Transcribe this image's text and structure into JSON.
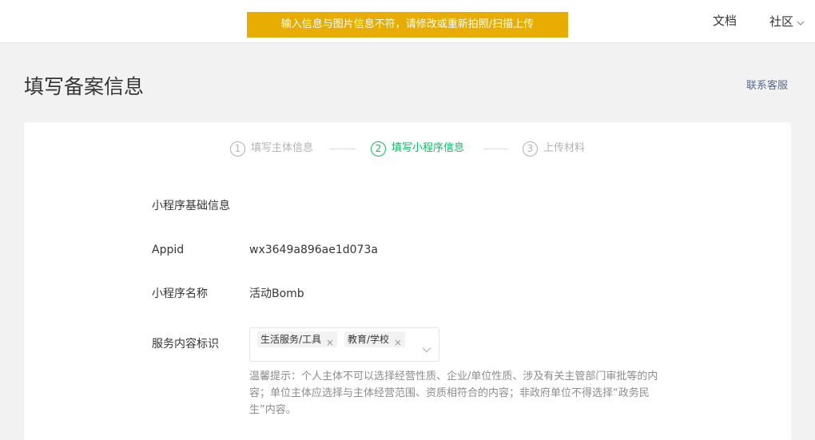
{
  "header": {
    "alert": "输入信息与图片信息不符，请修改或重新拍照/扫描上传",
    "nav_docs": "文档",
    "nav_community": "社区",
    "colors": {
      "alert_bg": "#e8ad00",
      "active": "#07c160",
      "link": "#576b95"
    }
  },
  "page": {
    "title": "填写备案信息",
    "support_link": "联系客服"
  },
  "steps": [
    {
      "num": "1",
      "label": "填写主体信息",
      "state": "done"
    },
    {
      "num": "2",
      "label": "填写小程序信息",
      "state": "active"
    },
    {
      "num": "3",
      "label": "上传材料",
      "state": "pending"
    }
  ],
  "form": {
    "section_title": "小程序基础信息",
    "appid": {
      "label": "Appid",
      "value": "wx3649a896ae1d073a"
    },
    "name": {
      "label": "小程序名称",
      "value": "活动Bomb"
    },
    "service": {
      "label": "服务内容标识",
      "tags": [
        "生活服务/工具",
        "教育/学校"
      ]
    },
    "hint": "温馨提示：个人主体不可以选择经营性质、企业/单位性质、涉及有关主管部门审批等的内容；单位主体应选择与主体经营范围、资质相符合的内容；非政府单位不得选择“政务民生”内容。"
  }
}
